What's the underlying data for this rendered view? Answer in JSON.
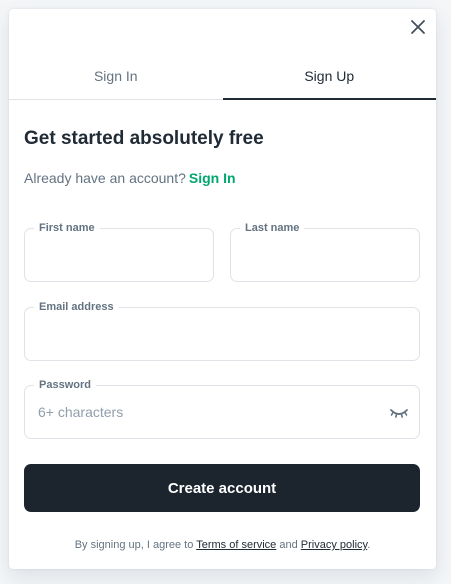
{
  "dialog": {
    "close_icon": "close-icon"
  },
  "tabs": [
    {
      "label": "Sign In",
      "active": false
    },
    {
      "label": "Sign Up",
      "active": true
    }
  ],
  "form": {
    "heading": "Get started absolutely free",
    "subtitle": "Already have an account?",
    "signin_link": "Sign In",
    "first_name": {
      "label": "First name",
      "value": "",
      "placeholder": ""
    },
    "last_name": {
      "label": "Last name",
      "value": "",
      "placeholder": ""
    },
    "email": {
      "label": "Email address",
      "value": "",
      "placeholder": ""
    },
    "password": {
      "label": "Password",
      "value": "",
      "placeholder": "6+ characters",
      "toggle_icon": "eye-closed-icon"
    },
    "submit_label": "Create account",
    "terms_prefix": "By signing up, I agree to",
    "terms_link": "Terms of service",
    "terms_and": "and",
    "privacy_link": "Privacy policy",
    "terms_suffix": "."
  },
  "colors": {
    "accent": "#00a76f",
    "button_bg": "#1c252e",
    "text_primary": "#212b36",
    "text_secondary": "#637381",
    "border": "#dfe3e8"
  }
}
